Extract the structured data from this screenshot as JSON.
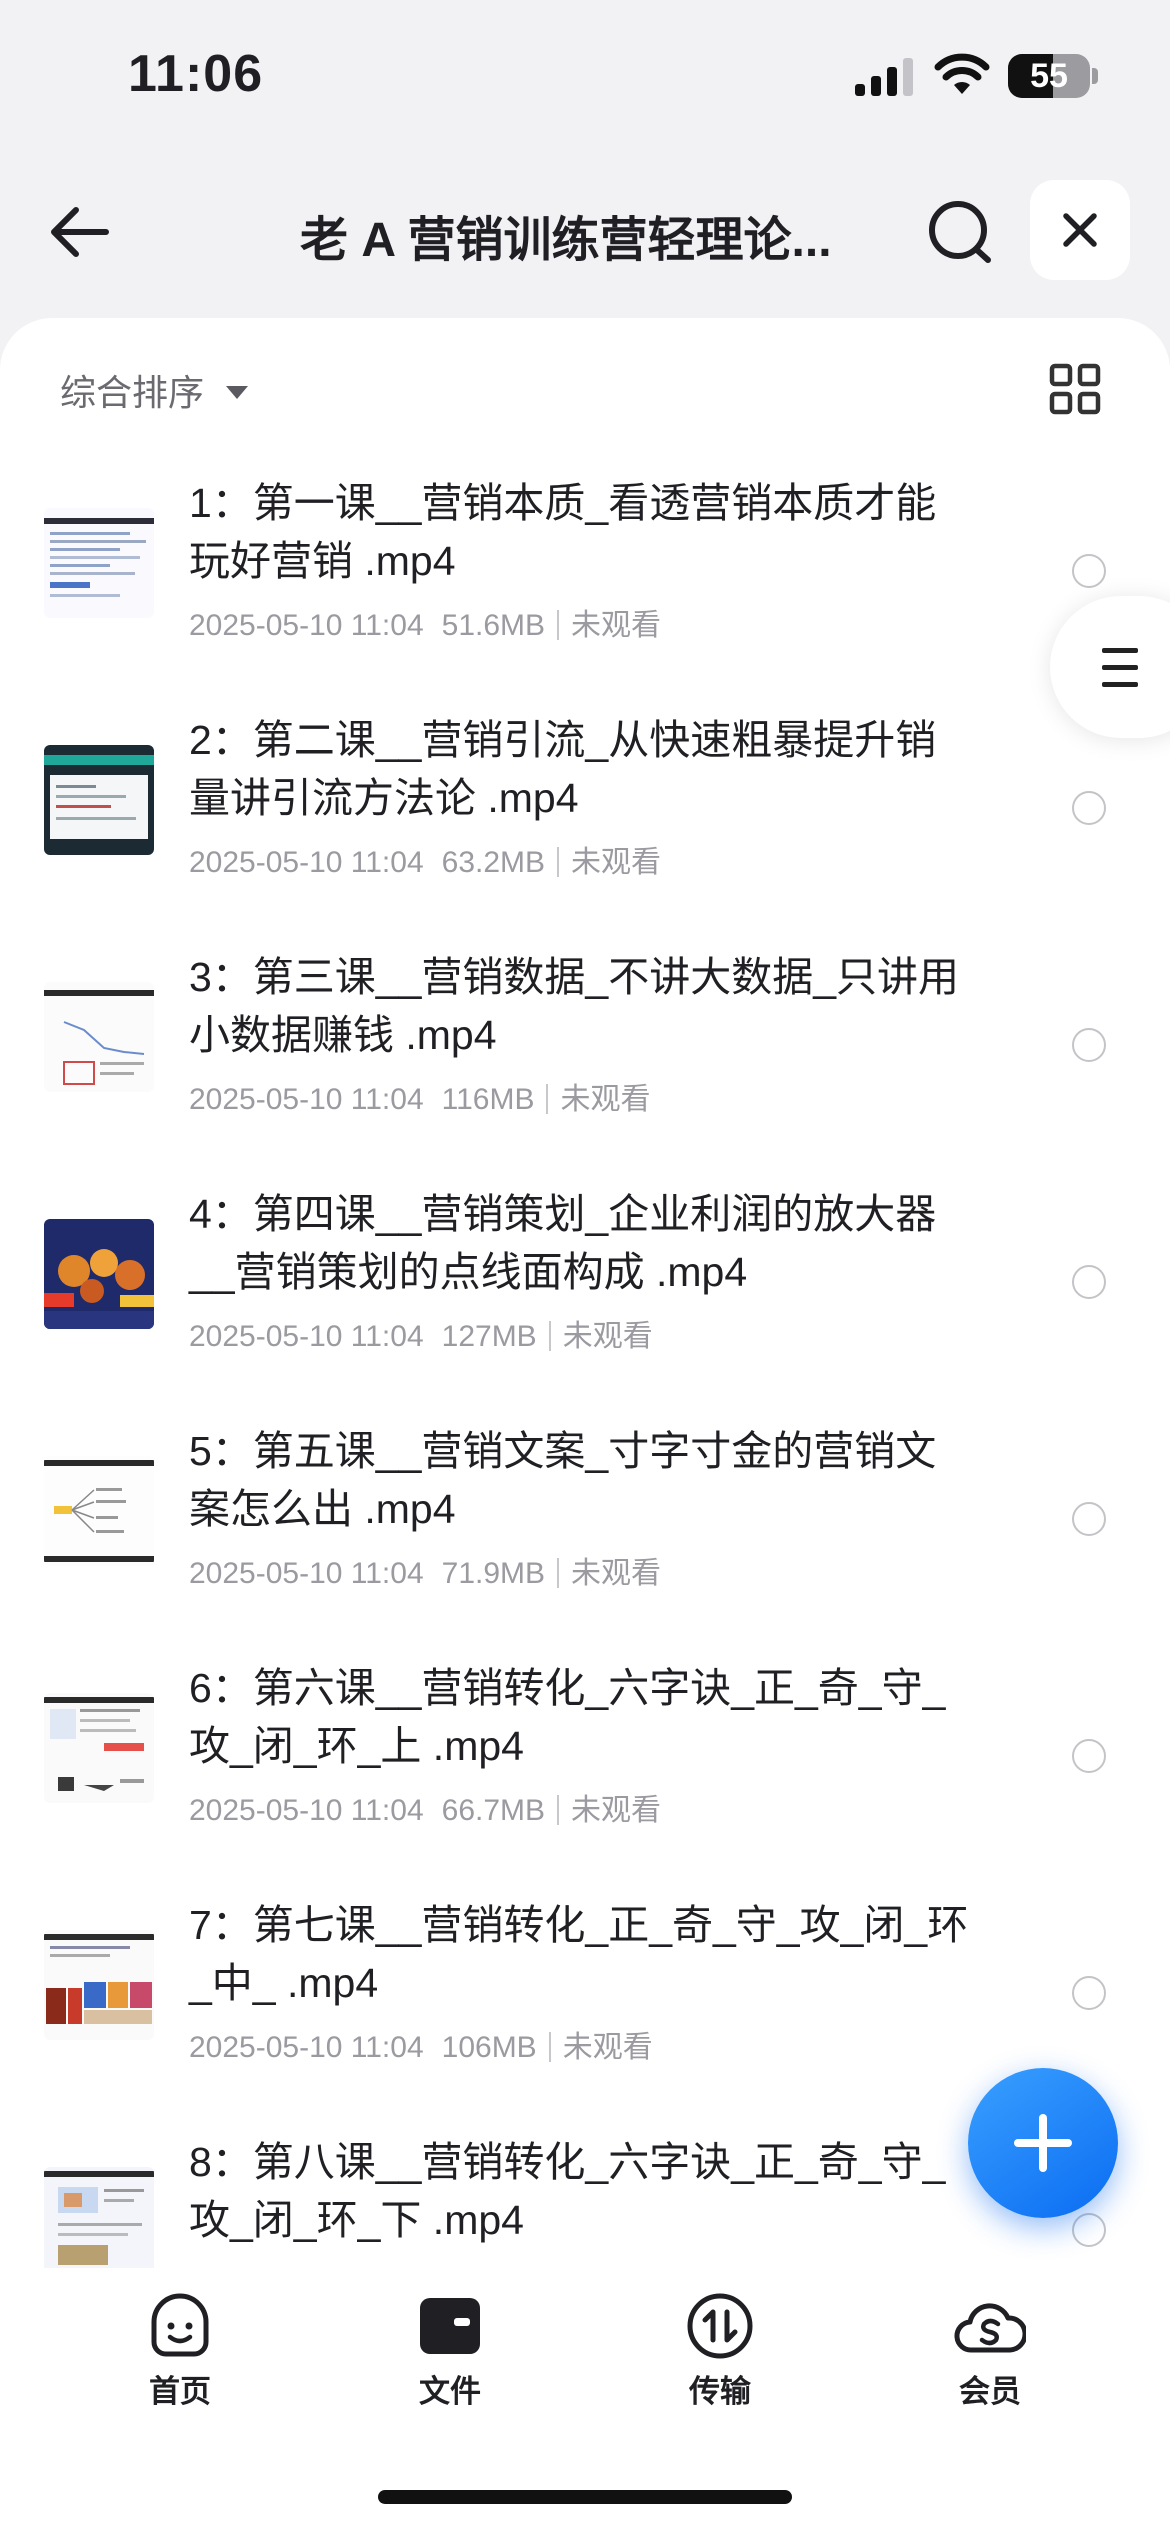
{
  "status_bar": {
    "time": "11:06",
    "battery_level": "55",
    "battery_fill": 0.55
  },
  "header": {
    "title": "老 A 营销训练营轻理论...",
    "back_icon": "arrow-left-icon",
    "search_icon": "search-icon",
    "close_icon": "close-icon"
  },
  "sort": {
    "label": "综合排序",
    "view_icon": "grid-view-icon"
  },
  "files": [
    {
      "name": "1：第一课__营销本质_看透营销本质才能玩好营销 .mp4",
      "date": "2025-05-10 11:04",
      "size": "51.6MB",
      "status": "未观看"
    },
    {
      "name": "2：第二课__营销引流_从快速粗暴提升销量讲引流方法论 .mp4",
      "date": "2025-05-10 11:04",
      "size": "63.2MB",
      "status": "未观看"
    },
    {
      "name": "3：第三课__营销数据_不讲大数据_只讲用小数据赚钱 .mp4",
      "date": "2025-05-10 11:04",
      "size": "116MB",
      "status": "未观看"
    },
    {
      "name": "4：第四课__营销策划_企业利润的放大器__营销策划的点线面构成 .mp4",
      "date": "2025-05-10 11:04",
      "size": "127MB",
      "status": "未观看"
    },
    {
      "name": "5：第五课__营销文案_寸字寸金的营销文案怎么出 .mp4",
      "date": "2025-05-10 11:04",
      "size": "71.9MB",
      "status": "未观看"
    },
    {
      "name": "6：第六课__营销转化_六字诀_正_奇_守_攻_闭_环_上 .mp4",
      "date": "2025-05-10 11:04",
      "size": "66.7MB",
      "status": "未观看"
    },
    {
      "name": "7：第七课__营销转化_正_奇_守_攻_闭_环_中_ .mp4",
      "date": "2025-05-10 11:04",
      "size": "106MB",
      "status": "未观看"
    },
    {
      "name": "8：第八课__营销转化_六字诀_正_奇_守_攻_闭_环_下 .mp4",
      "date": "",
      "size": "",
      "status": ""
    }
  ],
  "tabs": [
    {
      "label": "首页",
      "icon": "smile-face-icon"
    },
    {
      "label": "文件",
      "icon": "folder-icon"
    },
    {
      "label": "传输",
      "icon": "transfer-icon"
    },
    {
      "label": "会员",
      "icon": "cloud-s-icon"
    }
  ],
  "fab": {
    "icon": "plus-icon"
  },
  "side_menu": {
    "icon": "menu-icon"
  }
}
